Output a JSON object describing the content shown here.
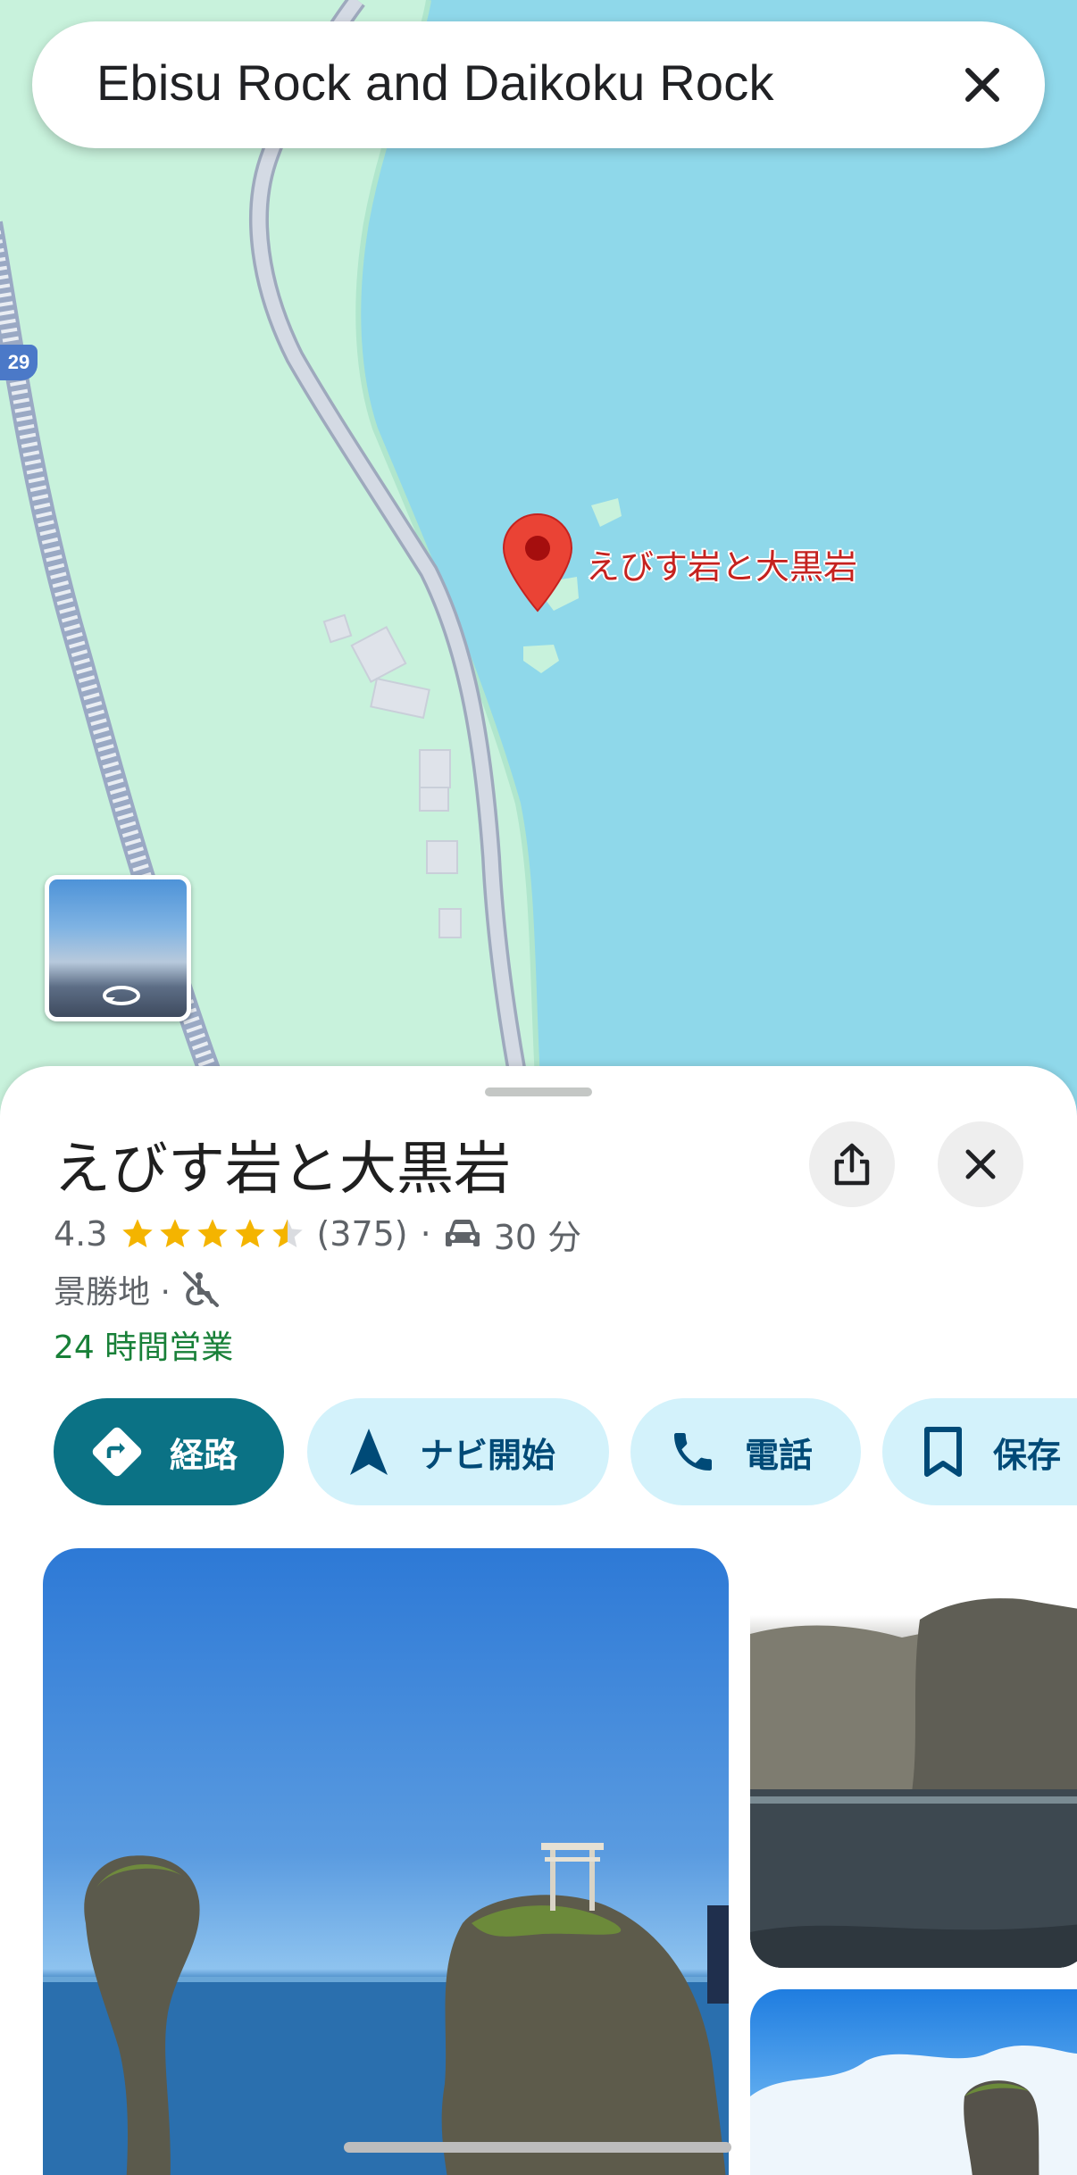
{
  "search": {
    "query": "Ebisu Rock and Daikoku Rock",
    "clear_icon": "close-icon"
  },
  "map": {
    "route_shield": "29",
    "place_label": "えびす岩と大黒岩",
    "pin_icon": "map-pin-icon",
    "streetview_icon": "360-rotate-icon",
    "colors": {
      "water": "#8fd8ea",
      "land": "#c8f2dc",
      "road": "#b9c4d6",
      "pin": "#ea4335"
    }
  },
  "place": {
    "title": "えびす岩と大黒岩",
    "rating": "4.3",
    "rating_value": 4.3,
    "review_count": "(375)",
    "separator": "·",
    "drive_time": "30 分",
    "category": "景勝地 ·",
    "accessibility_icon": "not-wheelchair-accessible-icon",
    "hours": "24 時間営業",
    "colors": {
      "star": "#f4b400",
      "open": "#188038"
    }
  },
  "actions": {
    "route": "経路",
    "navigate": "ナビ開始",
    "call": "電話",
    "save": "保存"
  }
}
